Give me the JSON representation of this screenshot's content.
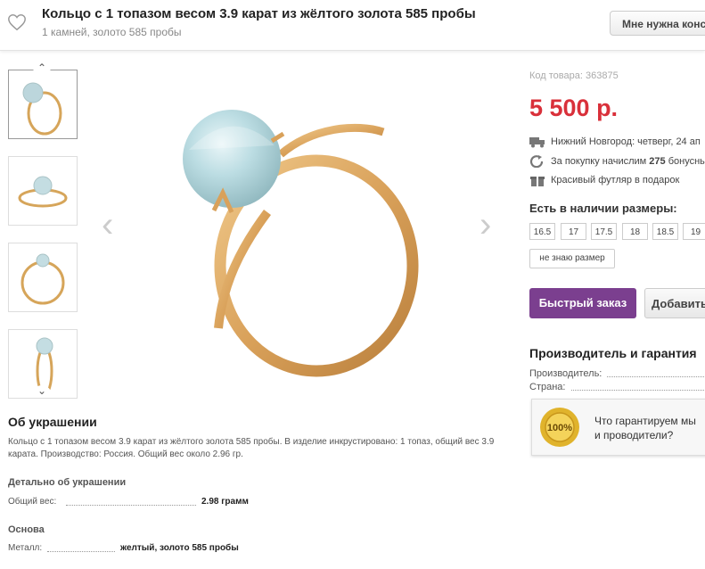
{
  "header": {
    "title": "Кольцо с 1 топазом весом 3.9 карат из жёлтого золота 585 пробы",
    "subtitle": "1 камней, золото 585 пробы",
    "consult_button": "Мне нужна консу"
  },
  "gallery": {
    "thumb_up_glyph": "⌃",
    "thumb_down_glyph": "⌄",
    "prev_glyph": "‹",
    "next_glyph": "›"
  },
  "product": {
    "code": "Код товара: 363875",
    "price": "5 500 р.",
    "delivery": "Нижний Новгород: четверг, 24 ап",
    "bonus_prefix": "За покупку начислим ",
    "bonus_value": "275",
    "bonus_suffix": " бонусны",
    "gift": "Красивый футляр в подарок",
    "sizes_title": "Есть в наличии размеры:",
    "sizes": [
      "16.5",
      "17",
      "17.5",
      "18",
      "18.5",
      "19"
    ],
    "no_size": "не знаю размер",
    "quick_order": "Быстрый заказ",
    "add_button": "Добавить"
  },
  "maker": {
    "title": "Производитель и гарантия",
    "producer_label": "Производитель:",
    "country_label": "Страна:",
    "guarantee_line1": "Что гарантируем мы",
    "guarantee_line2": "и проводители?",
    "medal_text": "100%"
  },
  "about": {
    "title": "Об украшении",
    "text": "Кольцо с 1 топазом весом 3.9 карат из жёлтого золота 585 пробы. В изделие инкрустировано: 1 топаз, общий вес 3.9 карата. Производство: Россия. Общий вес около 2.96 гр.",
    "details_title": "Детально об украшении",
    "weight_label": "Общий вес:",
    "weight_value": "2.98 грамм",
    "basis_title": "Основа",
    "metal_label": "Металл:",
    "metal_value": "желтый, золото 585 пробы"
  },
  "colors": {
    "price": "#d9303a",
    "quick_order": "#7b3f8f"
  }
}
